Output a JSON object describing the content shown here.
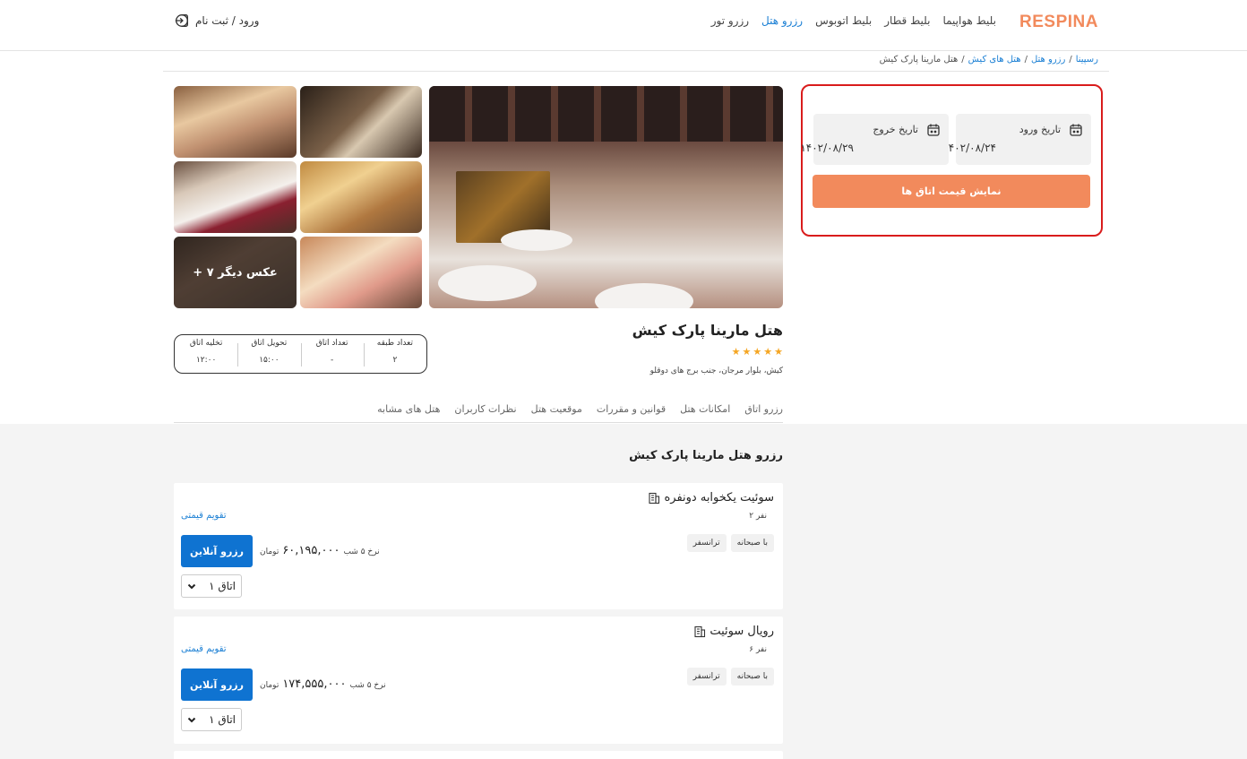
{
  "header": {
    "logo": "RESPINA",
    "nav": [
      {
        "label": "بلیط هواپیما",
        "active": false
      },
      {
        "label": "بلیط قطار",
        "active": false
      },
      {
        "label": "بلیط اتوبوس",
        "active": false
      },
      {
        "label": "رزرو هتل",
        "active": true
      },
      {
        "label": "رزرو تور",
        "active": false
      }
    ],
    "login_label": "ورود / ثبت نام",
    "login_icon": "login-icon"
  },
  "breadcrumb": [
    {
      "label": "رسپینا",
      "link": true
    },
    {
      "sep": "/"
    },
    {
      "label": "رزرو هتل",
      "link": true
    },
    {
      "sep": "/"
    },
    {
      "label": "هتل های کیش",
      "link": true
    },
    {
      "sep": "/"
    },
    {
      "label": "هتل مارینا پارک کیش",
      "link": false
    }
  ],
  "gallery": {
    "more_photos_label": "+ ۷ عکس دیگر"
  },
  "booking": {
    "checkin_label": "تاریخ ورود",
    "checkin_value": "۱۴۰۲/۰۸/۲۴",
    "checkout_label": "تاریخ خروج",
    "checkout_value": "۱۴۰۲/۰۸/۲۹",
    "show_prices_label": "نمایش قیمت اتاق ها",
    "calendar_icon": "calendar-icon"
  },
  "hotel": {
    "name": "هتل مارینا پارک کیش",
    "stars": 5,
    "address": "کیش، بلوار مرجان، جنب برج های دوقلو",
    "info": [
      {
        "key": "تعداد طبقه",
        "value": "۲"
      },
      {
        "key": "تعداد اتاق",
        "value": "-"
      },
      {
        "key": "تحویل اتاق",
        "value": "۱۵:۰۰"
      },
      {
        "key": "تخلیه اتاق",
        "value": "۱۲:۰۰"
      }
    ]
  },
  "tabs": [
    "رزرو اتاق",
    "امکانات هتل",
    "قوانین و مقررات",
    "موقعیت هتل",
    "نظرات کاربران",
    "هتل های مشابه"
  ],
  "section_title": "رزرو هتل مارینا پارک کیش",
  "rooms": [
    {
      "name": "سوئیت یکخوابه دونفره",
      "persons": "۲ نفر",
      "tags": [
        "با صبحانه",
        "ترانسفر"
      ],
      "price_calendar": "تقویم قیمتی",
      "price_prefix": "نرخ ۵ شب",
      "price_amount": "۶۰,۱۹۵,۰۰۰",
      "price_unit": "تومان",
      "book_label": "رزرو آنلاین",
      "room_count": "۱ اتاق"
    },
    {
      "name": "رویال سوئیت",
      "persons": "۶ نفر",
      "tags": [
        "با صبحانه",
        "ترانسفر"
      ],
      "price_calendar": "تقویم قیمتی",
      "price_prefix": "نرخ ۵ شب",
      "price_amount": "۱۷۴,۵۵۵,۰۰۰",
      "price_unit": "تومان",
      "book_label": "رزرو آنلاین",
      "room_count": "۱ اتاق"
    }
  ],
  "colors": {
    "brand_orange": "#f28a5c",
    "link_blue": "#1a7fd4",
    "button_blue": "#0f73d1",
    "highlight_red": "#d91c1c",
    "star_gold": "#f5a623"
  }
}
